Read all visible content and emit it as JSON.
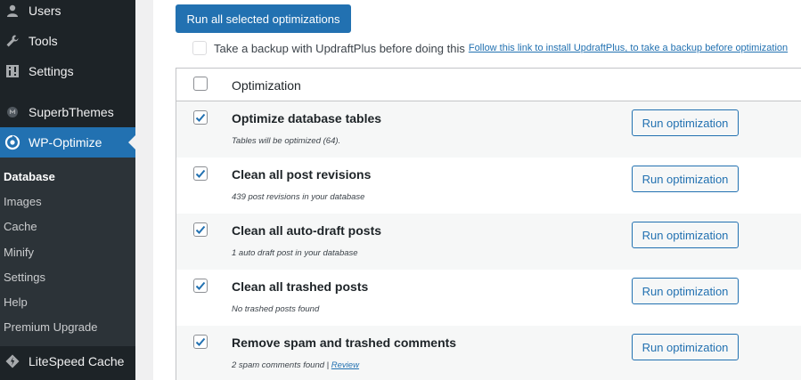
{
  "sidebar": {
    "menu": [
      {
        "label": "Users",
        "icon": "users-icon"
      },
      {
        "label": "Tools",
        "icon": "wrench-icon"
      },
      {
        "label": "Settings",
        "icon": "settings-icon"
      },
      {
        "label": "SuperbThemes",
        "icon": "superbthemes-icon"
      },
      {
        "label": "WP-Optimize",
        "icon": "wp-optimize-icon"
      },
      {
        "label": "LiteSpeed Cache",
        "icon": "litespeed-icon"
      }
    ],
    "submenu": [
      {
        "label": "Database"
      },
      {
        "label": "Images"
      },
      {
        "label": "Cache"
      },
      {
        "label": "Minify"
      },
      {
        "label": "Settings"
      },
      {
        "label": "Help"
      },
      {
        "label": "Premium Upgrade"
      }
    ]
  },
  "main": {
    "run_all_label": "Run all selected optimizations",
    "backup_text": "Take a backup with UpdraftPlus before doing this",
    "backup_link": "Follow this link to install UpdraftPlus, to take a backup before optimization",
    "table_header": "Optimization",
    "run_button_label": "Run optimization",
    "optimizations": [
      {
        "title": "Optimize database tables",
        "info": "Tables will be optimized (64).",
        "checked": true
      },
      {
        "title": "Clean all post revisions",
        "info": "439 post revisions in your database",
        "checked": true
      },
      {
        "title": "Clean all auto-draft posts",
        "info": "1 auto draft post in your database",
        "checked": true
      },
      {
        "title": "Clean all trashed posts",
        "info": "No trashed posts found",
        "checked": true
      },
      {
        "title": "Remove spam and trashed comments",
        "info": "2 spam comments found | ",
        "info_link": "Review",
        "checked": true
      }
    ]
  },
  "colors": {
    "sidebar_bg": "#1d2327",
    "submenu_bg": "#2c3338",
    "accent": "#2271b1"
  }
}
